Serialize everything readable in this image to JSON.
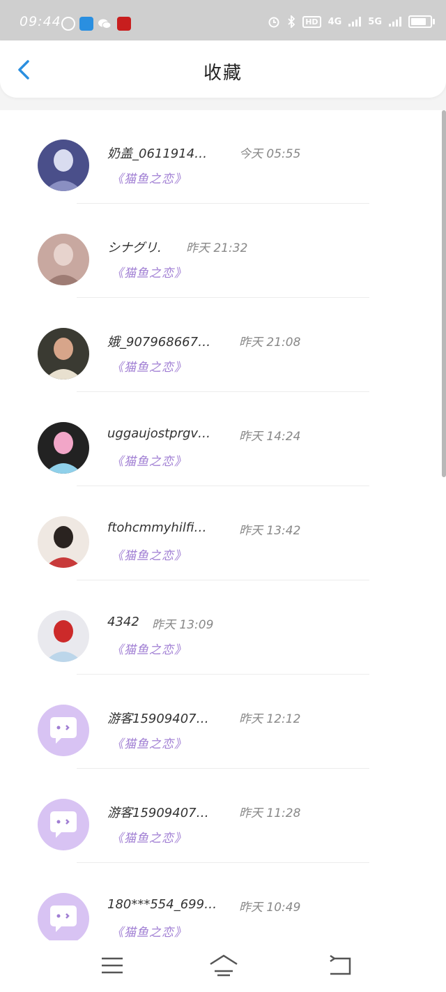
{
  "status_bar": {
    "time": "09:44",
    "network_hd": "HD",
    "network_4g": "4G",
    "network_5g": "5G",
    "battery_percent": 80
  },
  "header": {
    "title": "收藏",
    "back_icon": "chevron-left-icon"
  },
  "colors": {
    "accent": "#a07ed3",
    "back": "#2a8fe0",
    "status_bg": "#cfcfcf"
  },
  "favorites": [
    {
      "name": "奶盖_0611914…",
      "time": "今天 05:55",
      "tag": "《猫鱼之恋》",
      "avatar": "photo-group"
    },
    {
      "name": "シナグリ.",
      "time": "昨天 21:32",
      "tag": "《猫鱼之恋》",
      "avatar": "photo-anime"
    },
    {
      "name": "娥_907968667…",
      "time": "昨天 21:08",
      "tag": "《猫鱼之恋》",
      "avatar": "photo-child"
    },
    {
      "name": "uggaujostprgv…",
      "time": "昨天 14:24",
      "tag": "《猫鱼之恋》",
      "avatar": "photo-pink-hair"
    },
    {
      "name": "ftohcmmyhilfi…",
      "time": "昨天 13:42",
      "tag": "《猫鱼之恋》",
      "avatar": "photo-girl"
    },
    {
      "name": "4342",
      "time": "昨天 13:09",
      "tag": "《猫鱼之恋》",
      "avatar": "photo-ribbon"
    },
    {
      "name": "游客15909407…",
      "time": "昨天 12:12",
      "tag": "《猫鱼之恋》",
      "avatar": "default-chat"
    },
    {
      "name": "游客15909407…",
      "time": "昨天 11:28",
      "tag": "《猫鱼之恋》",
      "avatar": "default-chat"
    },
    {
      "name": "180***554_699…",
      "time": "昨天 10:49",
      "tag": "《猫鱼之恋》",
      "avatar": "default-chat"
    }
  ],
  "nav": {
    "menu_icon": "menu-icon",
    "home_icon": "home-icon",
    "back_icon": "back-icon"
  }
}
